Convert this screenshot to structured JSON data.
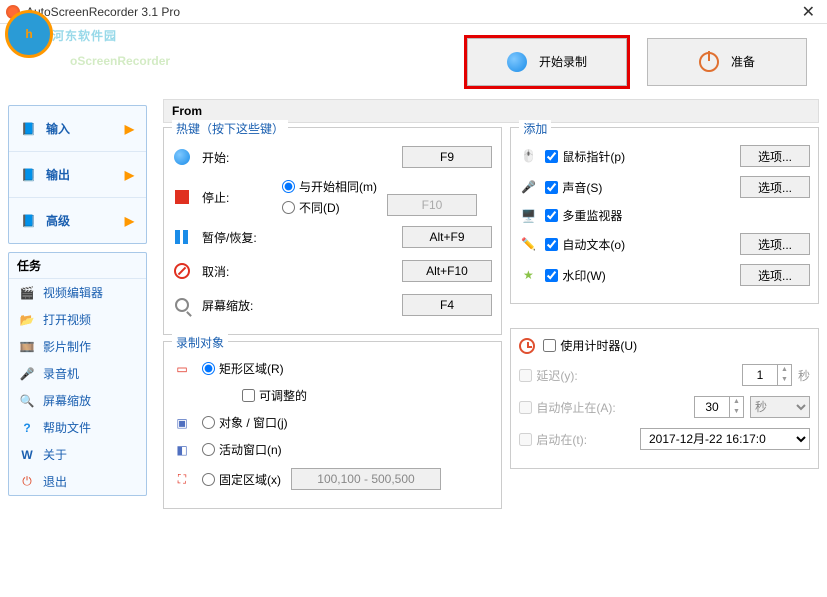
{
  "window": {
    "title": "AutoScreenRecorder 3.1 Pro"
  },
  "watermark": {
    "text": "河东软件园",
    "logo_letter": "h",
    "screen_text": "oScreenRecorder"
  },
  "topbar": {
    "record": "开始录制",
    "prepare": "准备"
  },
  "nav": {
    "input": "输入",
    "output": "输出",
    "advanced": "高级"
  },
  "tasks": {
    "header": "任务",
    "video_editor": "视频编辑器",
    "open_video": "打开视频",
    "movie_make": "影片制作",
    "recorder": "录音机",
    "screen_zoom": "屏幕缩放",
    "help": "帮助文件",
    "about": "关于",
    "exit": "退出"
  },
  "content": {
    "title": "From"
  },
  "hotkeys": {
    "legend": "热键（按下这些键）",
    "start": "开始:",
    "start_key": "F9",
    "stop": "停止:",
    "stop_same": "与开始相同(m)",
    "stop_diff": "不同(D)",
    "stop_key": "F10",
    "pause": "暂停/恢复:",
    "pause_key": "Alt+F9",
    "cancel": "取消:",
    "cancel_key": "Alt+F10",
    "zoom": "屏幕缩放:",
    "zoom_key": "F4"
  },
  "add": {
    "legend": "添加",
    "pointer": "鼠标指针(p)",
    "sound": "声音(S)",
    "monitor": "多重监视器",
    "autotext": "自动文本(o)",
    "watermark": "水印(W)",
    "options": "选项..."
  },
  "record_target": {
    "legend": "录制对象",
    "rect": "矩形区域(R)",
    "adjustable": "可调整的",
    "object": "对象 / 窗口(j)",
    "active": "活动窗口(n)",
    "fixed": "固定区域(x)",
    "coords": "100,100 - 500,500"
  },
  "timer": {
    "use": "使用计时器(U)",
    "delay": "延迟(y):",
    "delay_val": "1",
    "sec": "秒",
    "autostop": "自动停止在(A):",
    "autostop_val": "30",
    "startat": "启动在(t):",
    "datetime": "2017-12月-22 16:17:0"
  }
}
